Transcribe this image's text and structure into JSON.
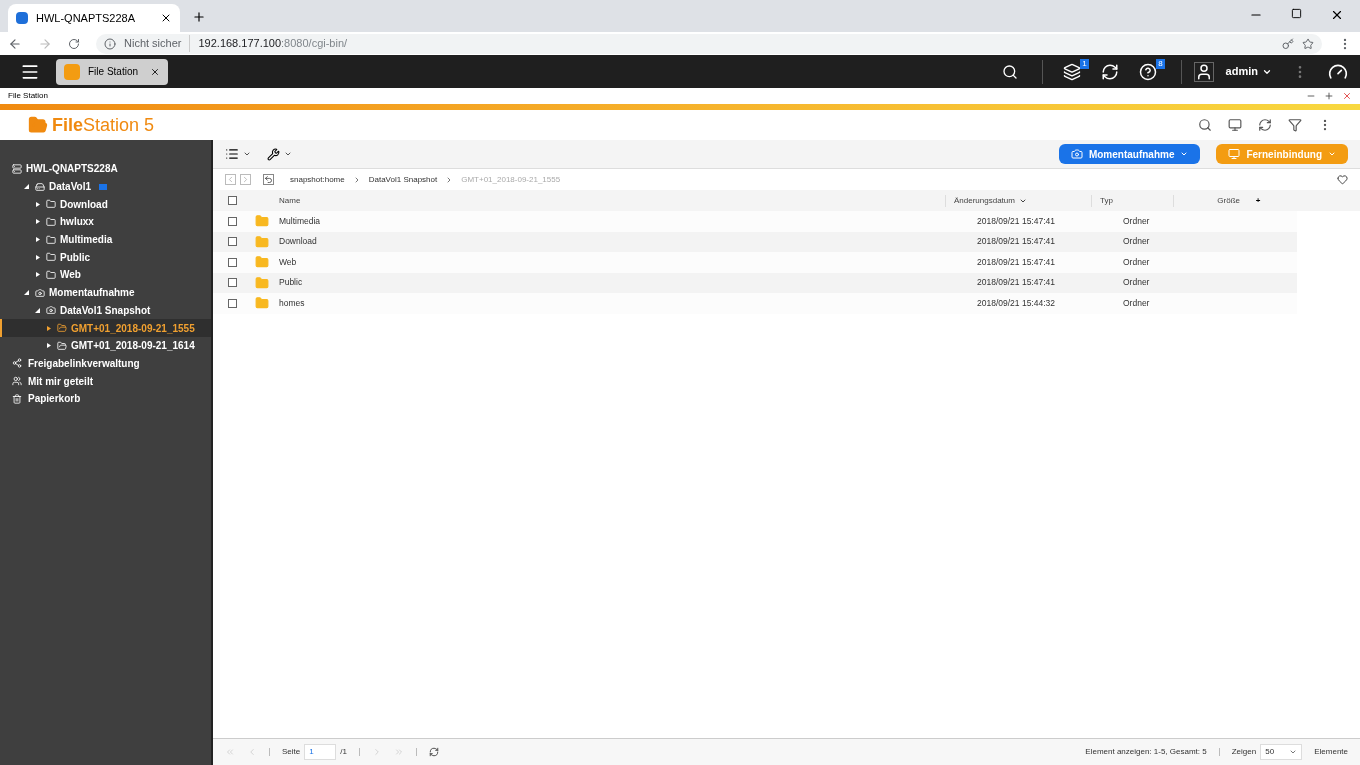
{
  "browser": {
    "tab_title": "HWL-QNAPTS228A",
    "security": "Nicht sicher",
    "url_host": "192.168.177.100",
    "url_rest": ":8080/cgi-bin/"
  },
  "topbar": {
    "app_tab": "File Station",
    "user": "admin",
    "badges": [
      {
        "kind": "tasks",
        "count": "1"
      },
      {
        "kind": "sync"
      },
      {
        "kind": "info",
        "count": "8"
      }
    ]
  },
  "window_title": "File Station",
  "logo": {
    "bold": "File",
    "rest": "Station 5"
  },
  "sidebar": {
    "root": "HWL-QNAPTS228A",
    "items": [
      {
        "label": "DataVol1",
        "kind": "drive",
        "expanded": true,
        "selected": false,
        "children": [
          {
            "label": "Download",
            "kind": "folder",
            "expanded": false,
            "selected": false
          },
          {
            "label": "hwluxx",
            "kind": "folder",
            "expanded": false,
            "selected": false
          },
          {
            "label": "Multimedia",
            "kind": "folder",
            "expanded": false,
            "selected": false
          },
          {
            "label": "Public",
            "kind": "folder",
            "expanded": false,
            "selected": false
          },
          {
            "label": "Web",
            "kind": "folder",
            "expanded": false,
            "selected": false
          }
        ]
      },
      {
        "label": "Momentaufnahme",
        "kind": "snapshot",
        "expanded": true,
        "selected": false,
        "children": [
          {
            "label": "DataVol1 Snapshot",
            "kind": "snapshot",
            "expanded": true,
            "selected": false,
            "children": [
              {
                "label": "GMT+01_2018-09-21_1555",
                "kind": "snapshot-folder",
                "expanded": false,
                "selected": true
              },
              {
                "label": "GMT+01_2018-09-21_1614",
                "kind": "snapshot-folder",
                "expanded": false,
                "selected": false
              }
            ]
          }
        ]
      }
    ],
    "extras": [
      {
        "label": "Freigabelinkverwaltung",
        "kind": "share"
      },
      {
        "label": "Mit mir geteilt",
        "kind": "shared"
      },
      {
        "label": "Papierkorb",
        "kind": "trash"
      }
    ]
  },
  "toolbar": {
    "buttons": [
      {
        "label": "Momentaufnahme",
        "color": "#1a73e8"
      },
      {
        "label": "Ferneinbindung",
        "color": "#f39c12"
      }
    ]
  },
  "breadcrumb": [
    "snapshot:home",
    "DataVol1 Snapshot",
    "GMT+01_2018-09-21_1555"
  ],
  "table": {
    "select_all_checked": false,
    "columns": [
      "Name",
      "Änderungsdatum",
      "Typ",
      "Größe"
    ],
    "add_column": "+",
    "rows": [
      {
        "name": "Multimedia",
        "date": "2018/09/21 15:47:41",
        "type": "Ordner",
        "checked": false
      },
      {
        "name": "Download",
        "date": "2018/09/21 15:47:41",
        "type": "Ordner",
        "checked": false
      },
      {
        "name": "Web",
        "date": "2018/09/21 15:47:41",
        "type": "Ordner",
        "checked": false
      },
      {
        "name": "Public",
        "date": "2018/09/21 15:47:41",
        "type": "Ordner",
        "checked": false
      },
      {
        "name": "homes",
        "date": "2018/09/21 15:44:32",
        "type": "Ordner",
        "checked": false
      }
    ]
  },
  "pager": {
    "page_label": "Seite",
    "page": "1",
    "total": "/1",
    "summary": "Element anzeigen: 1-5, Gesamt: 5",
    "show_label": "Zeigen",
    "per_page": "50",
    "unit": "Elemente"
  }
}
